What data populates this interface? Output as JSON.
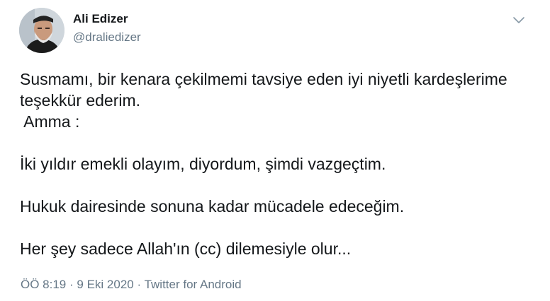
{
  "user": {
    "name": "Ali Edizer",
    "handle": "@draliedizer"
  },
  "tweet": {
    "lines": [
      "Susmamı, bir kenara çekilmemi tavsiye eden iyi niyetli kardeşlerime",
      "teşekkür ederim.",
      " Amma :",
      "",
      "İki yıldır emekli olayım, diyordum, şimdi vazgeçtim.",
      "",
      "Hukuk dairesinde sonuna kadar mücadele edeceğim.",
      "",
      "Her şey sadece Allah'ın (cc) dilemesiyle olur..."
    ]
  },
  "meta": {
    "time": "ÖÖ 8:19",
    "separator1": "·",
    "date": "9 Eki 2020",
    "separator2": "·",
    "source": "Twitter for Android"
  },
  "icons": {
    "menu": "chevron-down-icon",
    "avatar": "avatar"
  },
  "colors": {
    "text": "#14171a",
    "secondary": "#657786"
  }
}
